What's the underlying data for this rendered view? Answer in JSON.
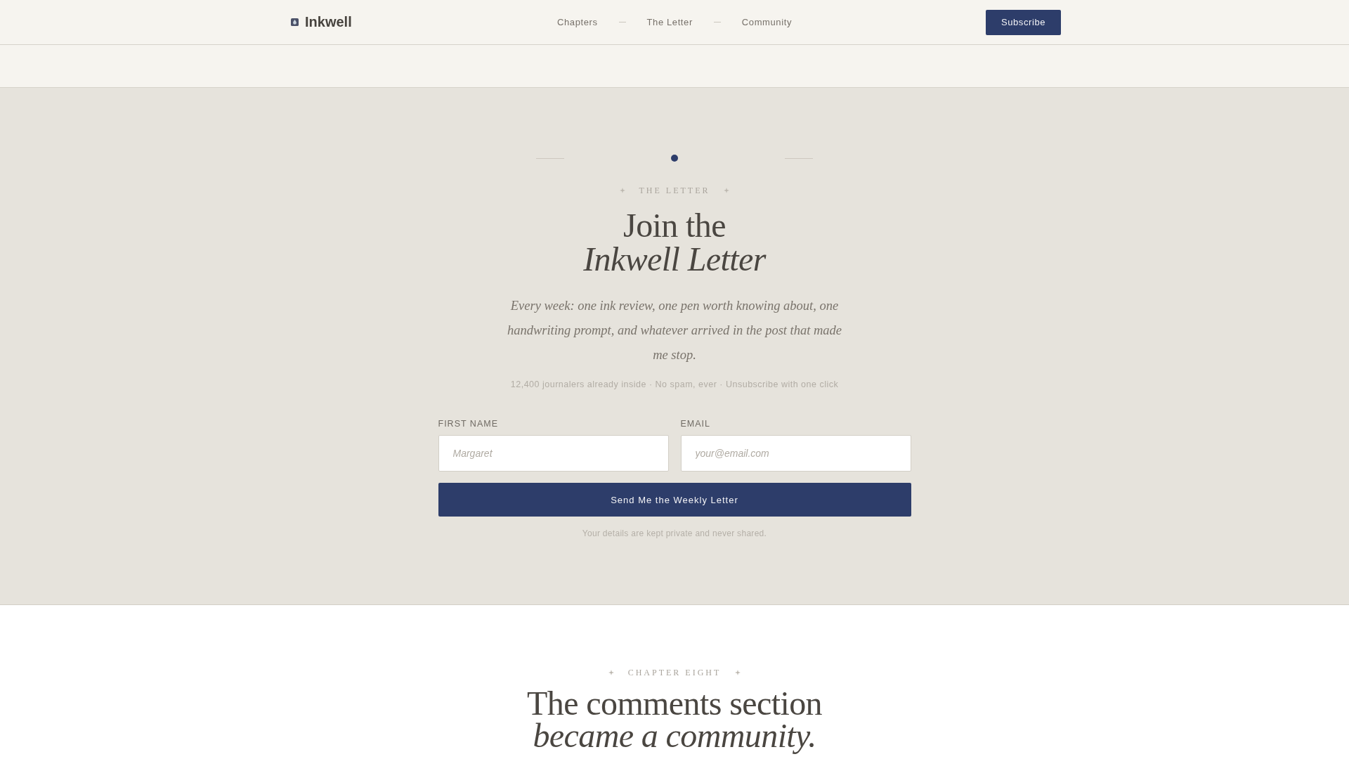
{
  "nav": {
    "brand": "Inkwell",
    "links": [
      "Chapters",
      "The Letter",
      "Community"
    ],
    "subscribe_button": "Subscribe"
  },
  "hero": {
    "eyebrow": "THE LETTER",
    "title": "Join the *Inkwell Letter*",
    "description": "Every week: one ink review, one pen worth knowing about, one handwriting prompt, and whatever arrived in the post that made me stop.",
    "stats": "12,400 journalers already inside · No spam, ever · Unsubscribe with one click",
    "form": {
      "fields": [
        {
          "label": "FIRST NAME",
          "placeholder": "Margaret"
        },
        {
          "label": "EMAIL",
          "placeholder": "your@email.com"
        }
      ],
      "submit_button": "Send Me the Weekly Letter",
      "note": "Your details are kept private and never shared."
    }
  },
  "next_section": {
    "eyebrow": "CHAPTER EIGHT",
    "title": "The comments section *became a community.*"
  }
}
